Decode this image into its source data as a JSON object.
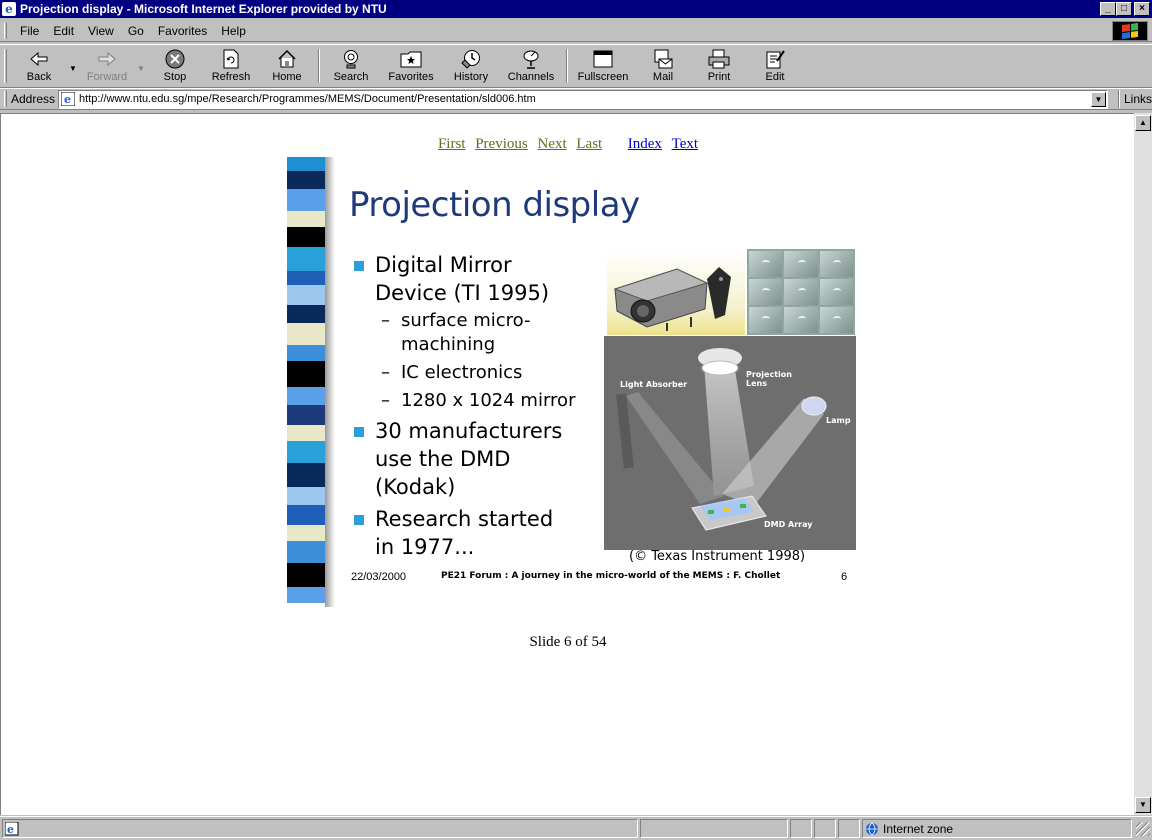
{
  "window": {
    "title": "Projection display - Microsoft Internet Explorer provided by NTU",
    "controls": [
      "_",
      "□",
      "×"
    ]
  },
  "menu": {
    "items": [
      "File",
      "Edit",
      "View",
      "Go",
      "Favorites",
      "Help"
    ]
  },
  "toolbar": {
    "back": "Back",
    "forward": "Forward",
    "stop": "Stop",
    "refresh": "Refresh",
    "home": "Home",
    "search": "Search",
    "favorites": "Favorites",
    "history": "History",
    "channels": "Channels",
    "fullscreen": "Fullscreen",
    "mail": "Mail",
    "print": "Print",
    "edit": "Edit"
  },
  "address": {
    "label": "Address",
    "url": "http://www.ntu.edu.sg/mpe/Research/Programmes/MEMS/Document/Presentation/sld006.htm",
    "links": "Links"
  },
  "slidenav": {
    "first": "First",
    "previous": "Previous",
    "next": "Next",
    "last": "Last",
    "index": "Index",
    "text": "Text"
  },
  "slide": {
    "title": "Projection display",
    "bullet1_line1": "Digital Mirror",
    "bullet1_line2": "Device (TI 1995)",
    "sub1_line1": "surface micro-",
    "sub1_line2": "machining",
    "sub2": "IC electronics",
    "sub3": "1280 x 1024 mirror",
    "bullet2_line1": "30 manufacturers",
    "bullet2_line2": "use the DMD",
    "bullet2_line3": "(Kodak)",
    "bullet3_line1": "Research started",
    "bullet3_line2": "in 1977...",
    "caption": "(© Texas Instrument 1998)",
    "date": "22/03/2000",
    "footer": "PE21 Forum : A journey in the micro-world of the MEMS : F. Chollet",
    "number": "6",
    "diagram_labels": {
      "light_absorber": "Light Absorber",
      "projection_lens": "Projection Lens",
      "lamp": "Lamp",
      "dmd_array": "DMD Array"
    }
  },
  "slide_count": "Slide 6 of 54",
  "statusbar": {
    "zone": "Internet zone"
  },
  "colors": {
    "title_bar": "#000080",
    "chrome": "#c0c0c0",
    "slide_title": "#1f3a7a",
    "bullet": "#2aa0d8",
    "visited_link": "#6b6b20",
    "link": "#0000cc"
  }
}
